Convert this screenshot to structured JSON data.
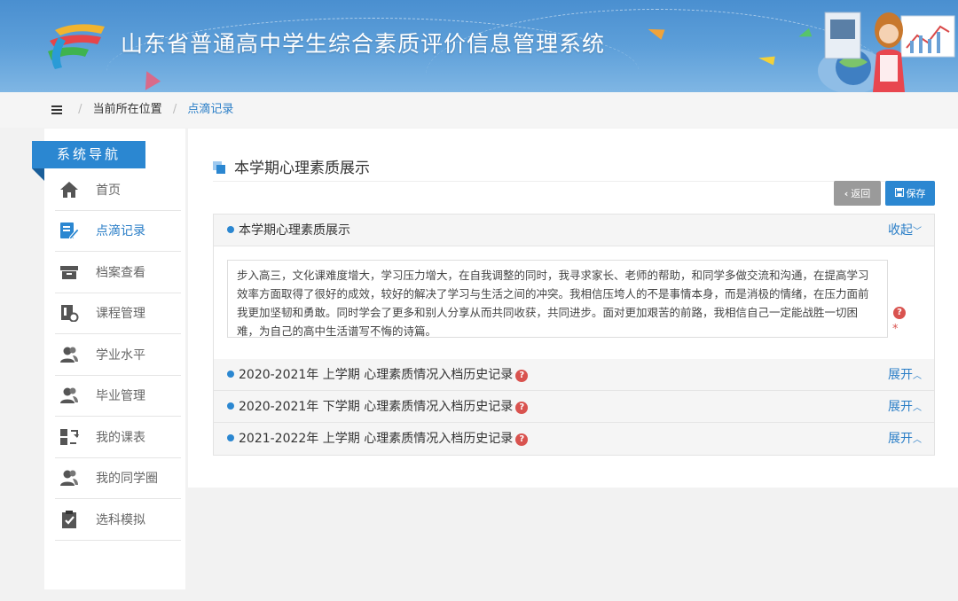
{
  "app": {
    "title": "山东省普通高中学生综合素质评价信息管理系统"
  },
  "breadcrumb": {
    "prefix": "当前所在位置",
    "current": "点滴记录"
  },
  "sidebar": {
    "heading": "系统导航",
    "items": [
      {
        "label": "首页",
        "icon": "home-icon"
      },
      {
        "label": "点滴记录",
        "icon": "edit-note-icon",
        "active": true
      },
      {
        "label": "档案查看",
        "icon": "archive-box-icon"
      },
      {
        "label": "课程管理",
        "icon": "course-document-icon"
      },
      {
        "label": "学业水平",
        "icon": "users-icon"
      },
      {
        "label": "毕业管理",
        "icon": "users-icon"
      },
      {
        "label": "我的课表",
        "icon": "schedule-swap-icon"
      },
      {
        "label": "我的同学圈",
        "icon": "users-icon"
      },
      {
        "label": "选科模拟",
        "icon": "clipboard-check-icon"
      }
    ]
  },
  "main": {
    "section_title": "本学期心理素质展示",
    "back_label": "返回",
    "save_label": "保存",
    "current": {
      "title": "本学期心理素质展示",
      "toggle": "收起",
      "content": "步入高三，文化课难度增大，学习压力增大，在自我调整的同时，我寻求家长、老师的帮助，和同学多做交流和沟通，在提高学习效率方面取得了很好的成效，较好的解决了学习与生活之间的冲突。我相信压垮人的不是事情本身，而是消极的情绪，在压力面前我更加坚韧和勇敢。同时学会了更多和别人分享从而共同收获，共同进步。面对更加艰苦的前路，我相信自己一定能战胜一切困难，为自己的高中生活谱写不悔的诗篇。",
      "required_mark": "*"
    },
    "history": [
      {
        "title": "2020-2021年 上学期 心理素质情况入档历史记录",
        "toggle": "展开"
      },
      {
        "title": "2020-2021年 下学期 心理素质情况入档历史记录",
        "toggle": "展开"
      },
      {
        "title": "2021-2022年 上学期 心理素质情况入档历史记录",
        "toggle": "展开"
      }
    ]
  },
  "colors": {
    "primary": "#2b87d1",
    "danger": "#d9534f",
    "header_top": "#4a8fd0",
    "header_bottom": "#7fb6e4"
  }
}
